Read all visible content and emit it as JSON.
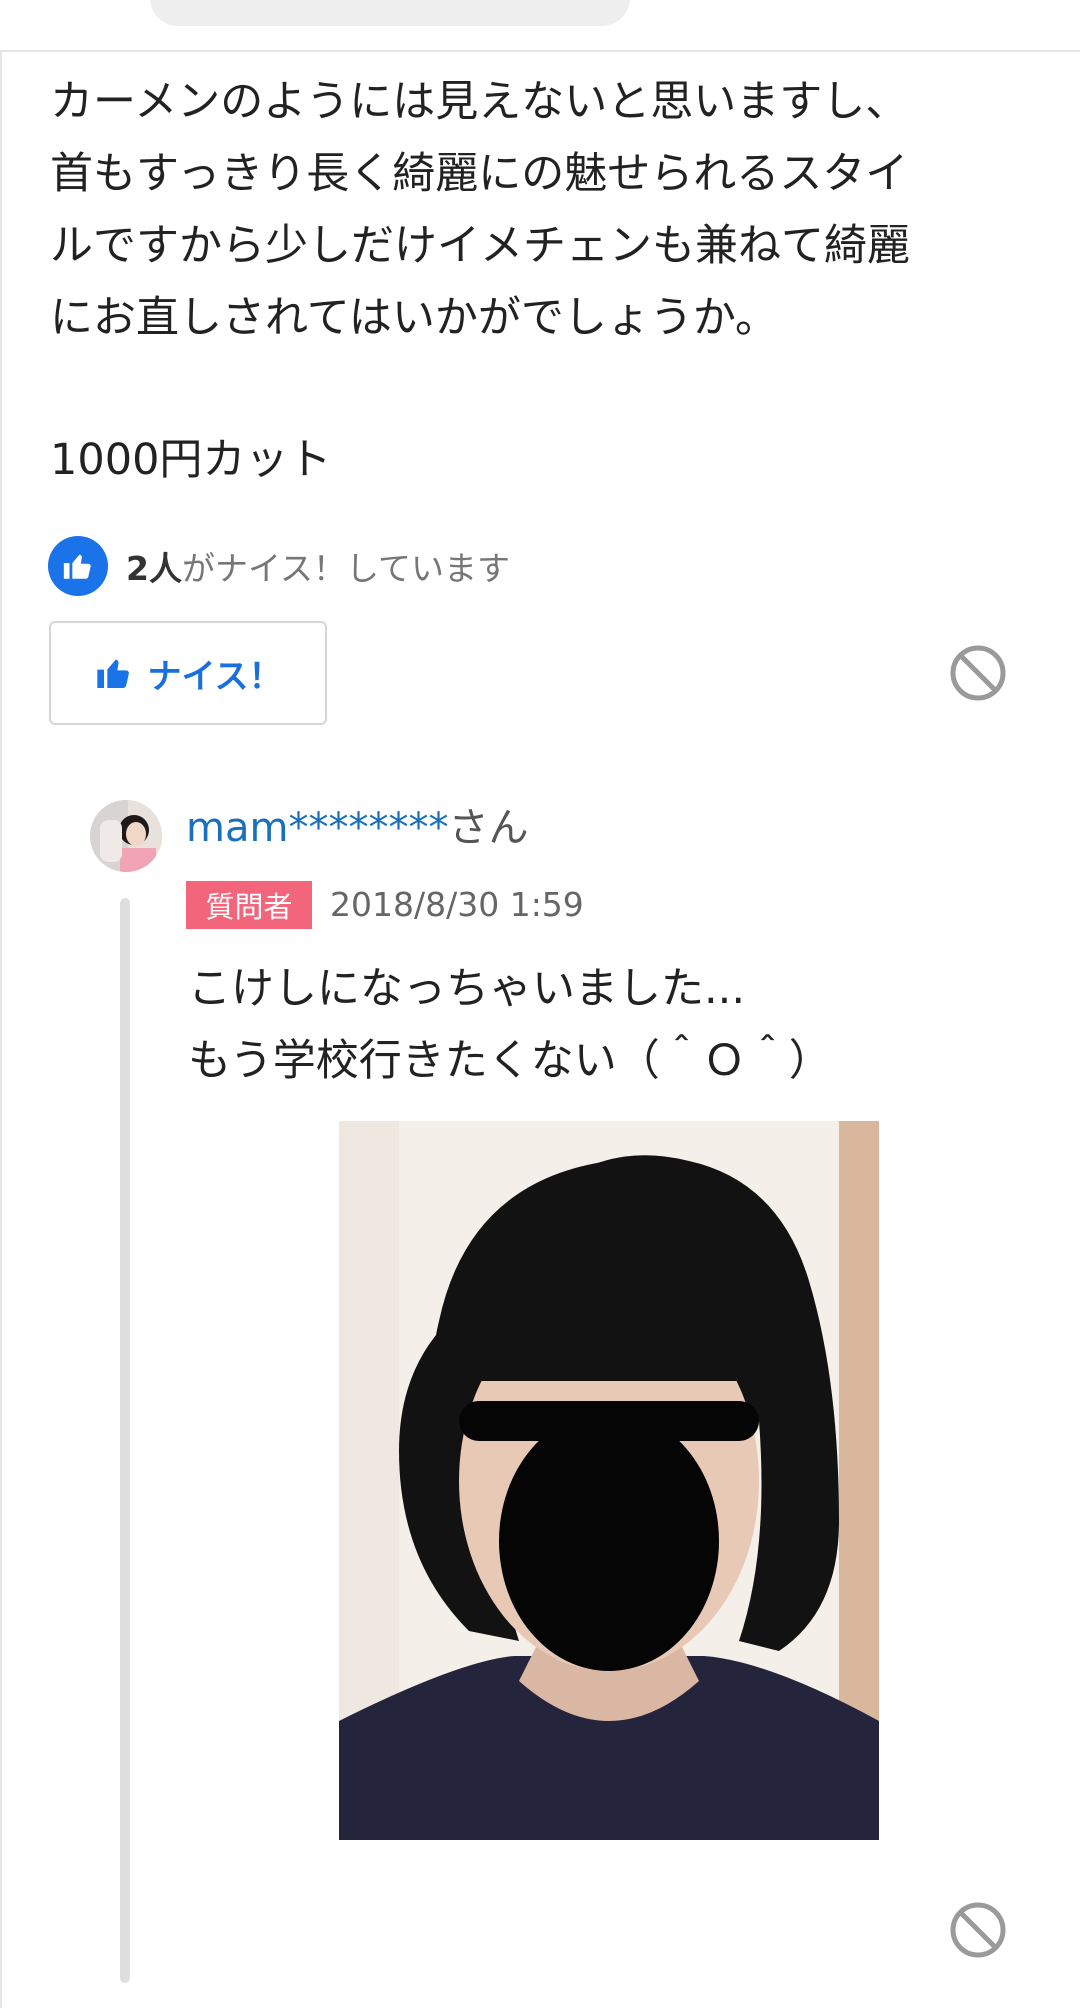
{
  "answer": {
    "lines": [
      "カーメンのようには見えないと思いますし、",
      "首もすっきり長く綺麗にの魅せられるスタイ",
      "ルですから少しだけイメチェンも兼ねて綺麗",
      "にお直しされてはいかがでしょうか。"
    ],
    "footer": "1000円カット",
    "nice_count": "2人",
    "nice_suffix": "がナイス！しています",
    "nice_button_label": "ナイス！"
  },
  "reply": {
    "user_name": "mam********",
    "user_suffix": "さん",
    "badge": "質問者",
    "timestamp": "2018/8/30 1:59",
    "lines": [
      "こけしになっちゃいました...",
      "もう学校行きたくない（＾Ｏ＾）"
    ]
  },
  "icons": {
    "thumbs_up": "thumbs-up-icon",
    "report": "block-icon"
  },
  "colors": {
    "accent": "#1a73e8",
    "username": "#1a6fbf",
    "badge_bg": "#f2657a"
  }
}
